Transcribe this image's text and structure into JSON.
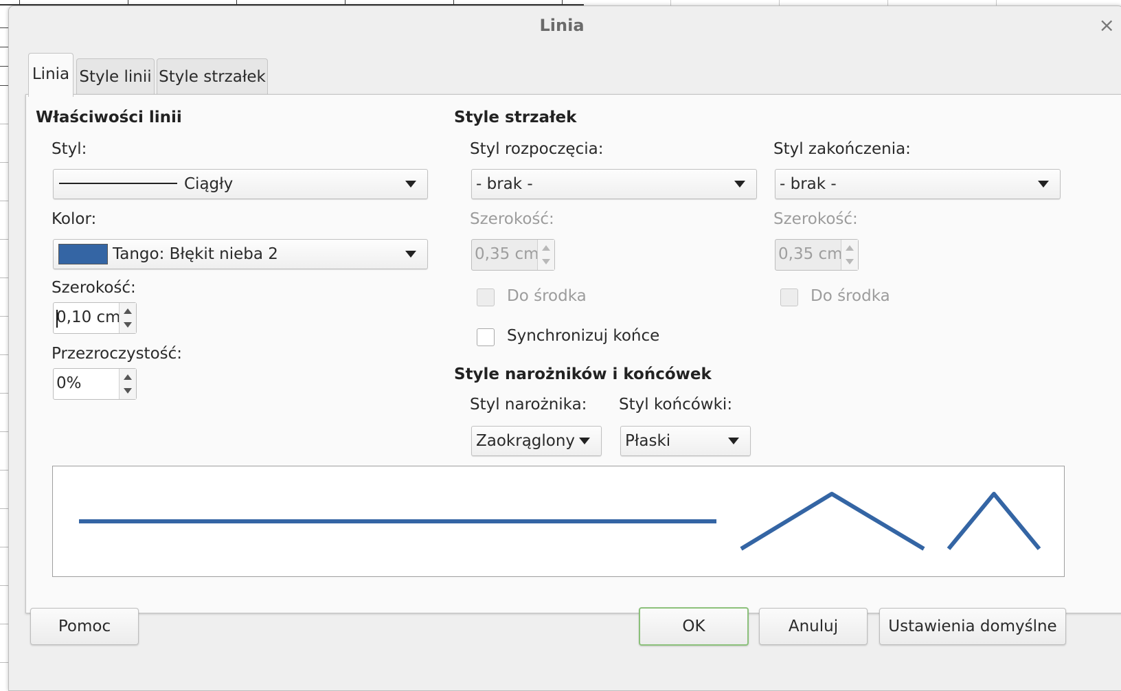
{
  "dialog": {
    "title": "Linia",
    "close_glyph": "×"
  },
  "tabs": [
    {
      "label": "Linia",
      "active": true
    },
    {
      "label": "Style linii",
      "active": false
    },
    {
      "label": "Style strzałek",
      "active": false
    }
  ],
  "line_properties": {
    "heading": "Właściwości linii",
    "style_label": "Styl:",
    "style_value": "Ciągły",
    "color_label": "Kolor:",
    "color_value": "Tango: Błękit nieba 2",
    "color_swatch": "#3465a4",
    "width_label": "Szerokość:",
    "width_value": "0,10 cm",
    "transparency_label": "Przezroczystość:",
    "transparency_value": "0%"
  },
  "arrow_styles": {
    "heading": "Style strzałek",
    "start_label": "Styl rozpoczęcia:",
    "start_value": "- brak -",
    "end_label": "Styl zakończenia:",
    "end_value": "- brak -",
    "start_width_label": "Szerokość:",
    "start_width_value": "0,35 cm",
    "end_width_label": "Szerokość:",
    "end_width_value": "0,35 cm",
    "start_center_label": "Do środka",
    "end_center_label": "Do środka",
    "sync_label": "Synchronizuj końce"
  },
  "corner_styles": {
    "heading": "Style narożników i końcówek",
    "corner_label": "Styl narożnika:",
    "corner_value": "Zaokrąglony",
    "cap_label": "Styl końcówki:",
    "cap_value": "Płaski"
  },
  "preview": {
    "line_color": "#3465a4"
  },
  "buttons": {
    "help": "Pomoc",
    "ok": "OK",
    "cancel": "Anuluj",
    "reset": "Ustawienia domyślne"
  },
  "colors": {
    "ok_border": "#8bc07a",
    "dialog_bg": "#efefef"
  }
}
